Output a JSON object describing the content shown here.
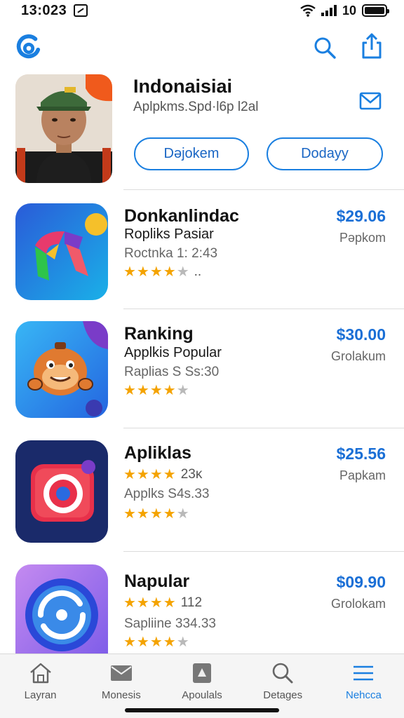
{
  "status_bar": {
    "time": "13:023",
    "battery_text": "10"
  },
  "icons": {
    "logo": "app-logo-icon",
    "search": "search-icon",
    "share": "share-icon",
    "mail": "mail-icon"
  },
  "profile": {
    "title": "Indonaisiai",
    "subtitle": "Aplpkms.Spd·l6p l2al",
    "button_left": "Dəjokem",
    "button_right": "Dodayy"
  },
  "apps": [
    {
      "name": "Donkanlindac",
      "line2": "Ropliks Pasiar",
      "line3": "Roctnka 1: 2:43",
      "rating_extra": "..",
      "price": "$29.06",
      "action": "Pəpkom"
    },
    {
      "name": "Ranking",
      "line2": "Applkis Popular",
      "line3": "Raplias S Ss:30",
      "rating_extra": "",
      "price": "$30.00",
      "action": "Grolakum"
    },
    {
      "name": "Apliklas",
      "line2_rating_extra": "23ᴋ",
      "line3": "Applks S4s.33",
      "rating_extra": "",
      "price": "$25.56",
      "action": "Papkam"
    },
    {
      "name": "Napular",
      "line2_rating_extra": "112",
      "line3": "Sapliine 334.33",
      "rating_extra": "",
      "price": "$09.90",
      "action": "Grolokam"
    }
  ],
  "tabs": [
    {
      "label": "Layran",
      "icon": "home-icon",
      "active": false
    },
    {
      "label": "Monesis",
      "icon": "mail-tray-icon",
      "active": false
    },
    {
      "label": "Apoulals",
      "icon": "apps-icon",
      "active": false
    },
    {
      "label": "Detages",
      "icon": "search-icon",
      "active": false
    },
    {
      "label": "Nehcca",
      "icon": "menu-icon",
      "active": true
    }
  ],
  "colors": {
    "accent": "#1a7fe0",
    "star": "#f4a300",
    "price": "#1a6fd6"
  }
}
